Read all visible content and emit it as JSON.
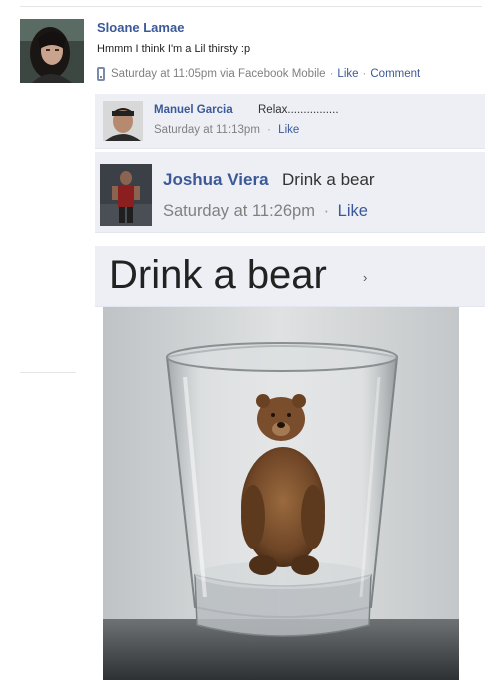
{
  "post": {
    "author": "Sloane Lamae",
    "message": "Hmmm I think I'm a Lil thirsty :p",
    "timestamp": "Saturday at 11:05pm via Facebook Mobile",
    "like_label": "Like",
    "comment_label": "Comment",
    "sep": "·"
  },
  "comments": [
    {
      "author": "Manuel Garcia",
      "text": "Relax................",
      "timestamp": "Saturday at 11:13pm",
      "like_label": "Like"
    },
    {
      "author": "Joshua Viera",
      "text": "Drink a bear",
      "timestamp": "Saturday at 11:26pm",
      "like_label": "Like"
    }
  ],
  "caption": {
    "text": "Drink a bear",
    "chevron": "›"
  },
  "colors": {
    "link": "#3b5998",
    "comment_bg": "#edeff4",
    "meta_gray": "#808080"
  },
  "icons": [
    "mobile-icon",
    "chevron-right-icon"
  ]
}
